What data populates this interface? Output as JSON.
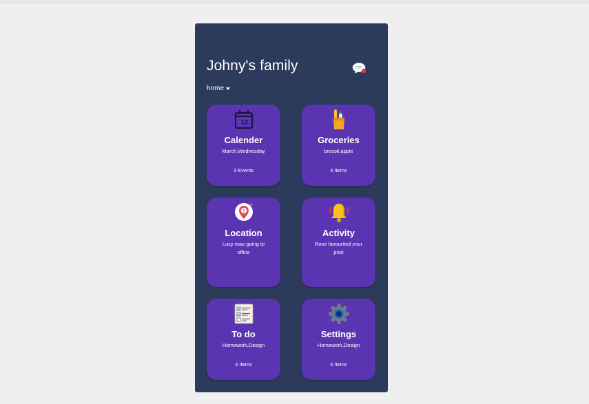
{
  "header": {
    "title": "Johny's family",
    "dropdown_value": "home",
    "chat_icon": "chat-notification-icon"
  },
  "cards": [
    {
      "title": "Calender",
      "subtitle": "March,Wednesday",
      "count": "3 Events",
      "icon": "calendar-icon",
      "icon_text": "12"
    },
    {
      "title": "Groceries",
      "subtitle": "brocoli,apple",
      "count": "4 Items",
      "icon": "grocery-bag-icon"
    },
    {
      "title": "Location",
      "subtitle": "Lucy mao going to office",
      "count": "",
      "icon": "location-pin-icon"
    },
    {
      "title": "Activity",
      "subtitle": "Rose favourited your post",
      "count": "",
      "icon": "bell-icon"
    },
    {
      "title": "To do",
      "subtitle": "Homework,Design",
      "count": "4 Items",
      "icon": "checklist-icon"
    },
    {
      "title": "Settings",
      "subtitle": "Homework,Design",
      "count": "4 Items",
      "icon": "gear-icon"
    }
  ],
  "colors": {
    "page_bg": "#efefef",
    "panel_bg": "#2c3a5b",
    "card_bg": "#5b34b2",
    "text": "#ffffff"
  }
}
